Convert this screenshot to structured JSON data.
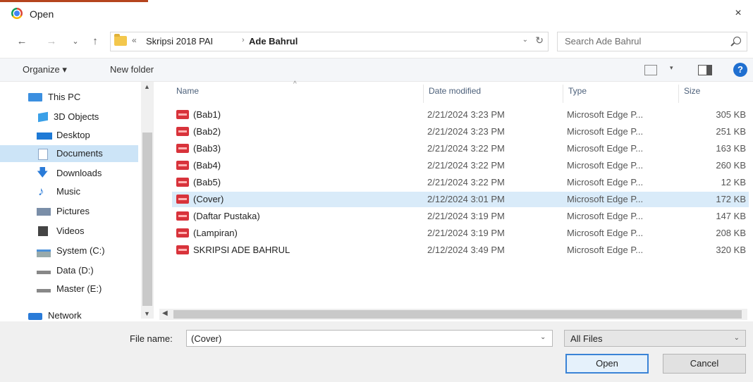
{
  "window": {
    "title": "Open",
    "close_glyph": "×",
    "icon": "chrome-icon"
  },
  "nav": {
    "back": "←",
    "forward": "→",
    "recent": "⌄",
    "up": "↑"
  },
  "address": {
    "overflow": "«",
    "crumbs": [
      "Skripsi 2018 PAI",
      "Ade Bahrul"
    ],
    "separator": "›",
    "dropdown": "⌄",
    "refresh": "↻"
  },
  "search": {
    "placeholder": "Search Ade Bahrul"
  },
  "toolbar": {
    "organize": "Organize ▾",
    "new_folder": "New folder",
    "view_drop": "▾",
    "help": "?"
  },
  "sidebar": {
    "items": [
      {
        "label": "This PC",
        "icon": "computer-icon",
        "color": "#3b8fe0"
      },
      {
        "label": "3D Objects",
        "icon": "cube-icon",
        "color": "#3aa0e8"
      },
      {
        "label": "Desktop",
        "icon": "desktop-icon",
        "color": "#1e7ad6"
      },
      {
        "label": "Documents",
        "icon": "document-icon",
        "color": "#8aa6c8"
      },
      {
        "label": "Downloads",
        "icon": "download-arrow-icon",
        "color": "#2a7bd8"
      },
      {
        "label": "Music",
        "icon": "music-note-icon",
        "color": "#2a7bd8"
      },
      {
        "label": "Pictures",
        "icon": "pictures-icon",
        "color": "#7a8ea8"
      },
      {
        "label": "Videos",
        "icon": "film-icon",
        "color": "#444444"
      },
      {
        "label": "System (C:)",
        "icon": "windows-drive-icon",
        "color": "#4a90d9"
      },
      {
        "label": "Data (D:)",
        "icon": "drive-icon",
        "color": "#888888"
      },
      {
        "label": "Master (E:)",
        "icon": "drive-icon",
        "color": "#888888"
      },
      {
        "label": "Network",
        "icon": "network-icon",
        "color": "#2a7bd8"
      }
    ],
    "selected_index": 3,
    "scroll_up": "▲",
    "scroll_down": "▼"
  },
  "columns": {
    "name": "Name",
    "date": "Date modified",
    "type": "Type",
    "size": "Size",
    "sort_indicator": "^"
  },
  "files": [
    {
      "name": "(Bab1)",
      "date": "2/21/2024 3:23 PM",
      "type": "Microsoft Edge P...",
      "size": "305 KB"
    },
    {
      "name": "(Bab2)",
      "date": "2/21/2024 3:23 PM",
      "type": "Microsoft Edge P...",
      "size": "251 KB"
    },
    {
      "name": "(Bab3)",
      "date": "2/21/2024 3:22 PM",
      "type": "Microsoft Edge P...",
      "size": "163 KB"
    },
    {
      "name": "(Bab4)",
      "date": "2/21/2024 3:22 PM",
      "type": "Microsoft Edge P...",
      "size": "260 KB"
    },
    {
      "name": "(Bab5)",
      "date": "2/21/2024 3:22 PM",
      "type": "Microsoft Edge P...",
      "size": "12 KB"
    },
    {
      "name": "(Cover)",
      "date": "2/12/2024 3:01 PM",
      "type": "Microsoft Edge P...",
      "size": "172 KB"
    },
    {
      "name": "(Daftar Pustaka)",
      "date": "2/21/2024 3:19 PM",
      "type": "Microsoft Edge P...",
      "size": "147 KB"
    },
    {
      "name": "(Lampiran)",
      "date": "2/21/2024 3:19 PM",
      "type": "Microsoft Edge P...",
      "size": "208 KB"
    },
    {
      "name": "SKRIPSI ADE BAHRUL",
      "date": "2/12/2024 3:49 PM",
      "type": "Microsoft Edge P...",
      "size": "320 KB"
    }
  ],
  "selected_file_index": 5,
  "hscroll": {
    "left": "◀"
  },
  "footer": {
    "file_name_label": "File name:",
    "file_name_value": "(Cover)",
    "file_name_drop": "⌄",
    "file_type": "All Files",
    "file_type_drop": "⌄",
    "open": "Open",
    "cancel": "Cancel"
  },
  "colors": {
    "accent": "#3a83d6",
    "selection": "#cce4f7",
    "pdf_red": "#d8333b"
  }
}
